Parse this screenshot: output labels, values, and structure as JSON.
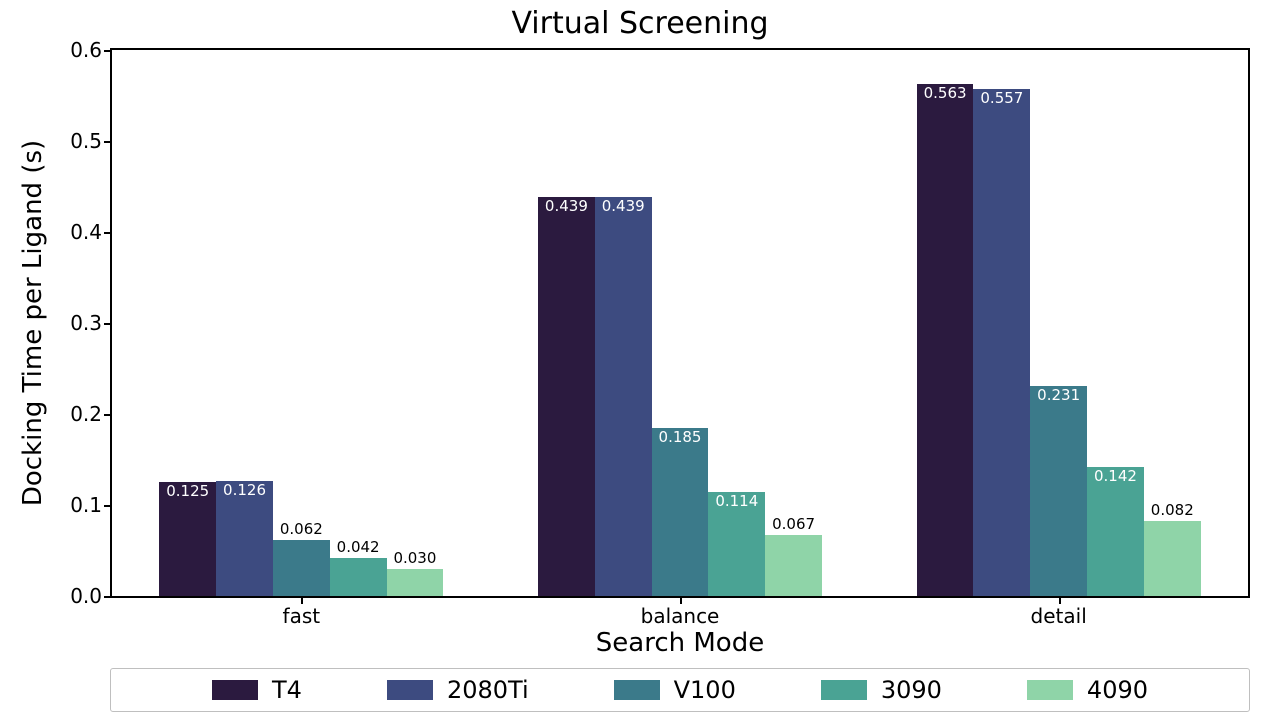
{
  "chart_data": {
    "type": "bar",
    "title": "Virtual Screening",
    "xlabel": "Search Mode",
    "ylabel": "Docking Time per Ligand (s)",
    "categories": [
      "fast",
      "balance",
      "detail"
    ],
    "series": [
      {
        "name": "T4",
        "color": "#2b1a3f",
        "values": [
          0.125,
          0.439,
          0.563
        ]
      },
      {
        "name": "2080Ti",
        "color": "#3d4b80",
        "values": [
          0.126,
          0.439,
          0.557
        ]
      },
      {
        "name": "V100",
        "color": "#3b7a8a",
        "values": [
          0.062,
          0.185,
          0.231
        ]
      },
      {
        "name": "3090",
        "color": "#4aa394",
        "values": [
          0.042,
          0.114,
          0.142
        ]
      },
      {
        "name": "4090",
        "color": "#8fd4a8",
        "values": [
          0.03,
          0.067,
          0.082
        ]
      }
    ],
    "ylim": [
      0,
      0.6
    ],
    "yticks": [
      0.0,
      0.1,
      0.2,
      0.3,
      0.4,
      0.5,
      0.6
    ],
    "ytick_labels": [
      "0.0",
      "0.1",
      "0.2",
      "0.3",
      "0.4",
      "0.5",
      "0.6"
    ],
    "value_labels": [
      [
        "0.125",
        "0.126",
        "0.062",
        "0.042",
        "0.030"
      ],
      [
        "0.439",
        "0.439",
        "0.185",
        "0.114",
        "0.067"
      ],
      [
        "0.563",
        "0.557",
        "0.231",
        "0.142",
        "0.082"
      ]
    ],
    "value_label_colors": [
      [
        "#ffffff",
        "#ffffff",
        "#000000",
        "#000000",
        "#000000"
      ],
      [
        "#ffffff",
        "#ffffff",
        "#ffffff",
        "#ffffff",
        "#000000"
      ],
      [
        "#ffffff",
        "#ffffff",
        "#ffffff",
        "#ffffff",
        "#000000"
      ]
    ],
    "legend_position": "bottom"
  }
}
